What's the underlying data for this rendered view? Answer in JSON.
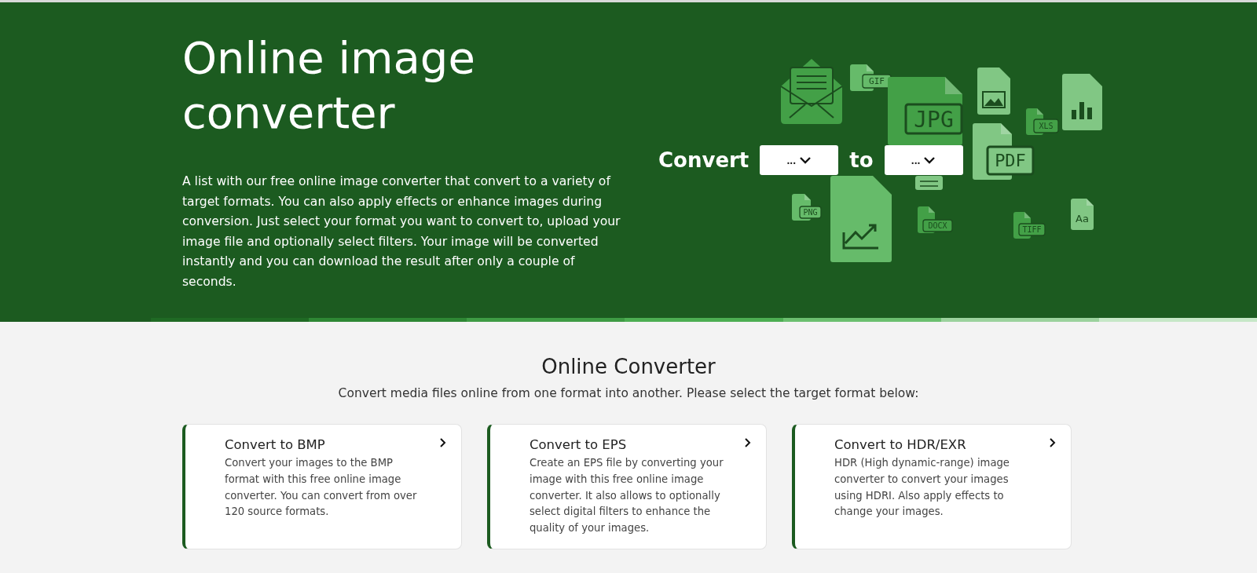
{
  "hero": {
    "title": "Online image converter",
    "description": "A list with our free online image converter that convert to a variety of target formats. You can also apply effects or enhance images during conversion. Just select your format you want to convert to, upload your image file and optionally select filters. Your image will be converted instantly and you can download the result after only a couple of seconds.",
    "converter": {
      "label": "Convert",
      "from": {
        "value": "..."
      },
      "connector": "to",
      "to": {
        "value": "..."
      }
    },
    "art_files": [
      {
        "kind": "badge",
        "label": "GIF",
        "color": "#66bb6a"
      },
      {
        "kind": "badge",
        "label": "JPG",
        "color": "#43a047"
      },
      {
        "kind": "badge",
        "label": "PDF",
        "color": "#81c784"
      },
      {
        "kind": "badge",
        "label": "XLS",
        "color": "#43a047"
      },
      {
        "kind": "badge",
        "label": "PNG",
        "color": "#66bb6a"
      },
      {
        "kind": "badge",
        "label": "DOCX",
        "color": "#43a047"
      },
      {
        "kind": "badge",
        "label": "TIFF",
        "color": "#43a047"
      },
      {
        "kind": "glyph",
        "label": "Aa",
        "color": "#81c784"
      }
    ]
  },
  "section": {
    "title": "Online Converter",
    "subtitle": "Convert media files online from one format into another. Please select the target format below:"
  },
  "cards": [
    {
      "title": "Convert to BMP",
      "text": "Convert your images to the BMP format with this free online image converter. You can convert from over 120 source formats."
    },
    {
      "title": "Convert to EPS",
      "text": "Create an EPS file by converting your image with this free online image converter. It also allows to optionally select digital filters to enhance the quality of your images."
    },
    {
      "title": "Convert to HDR/EXR",
      "text": "HDR (High dynamic-range) image converter to convert your images using HDRI. Also apply effects to change your images."
    }
  ]
}
